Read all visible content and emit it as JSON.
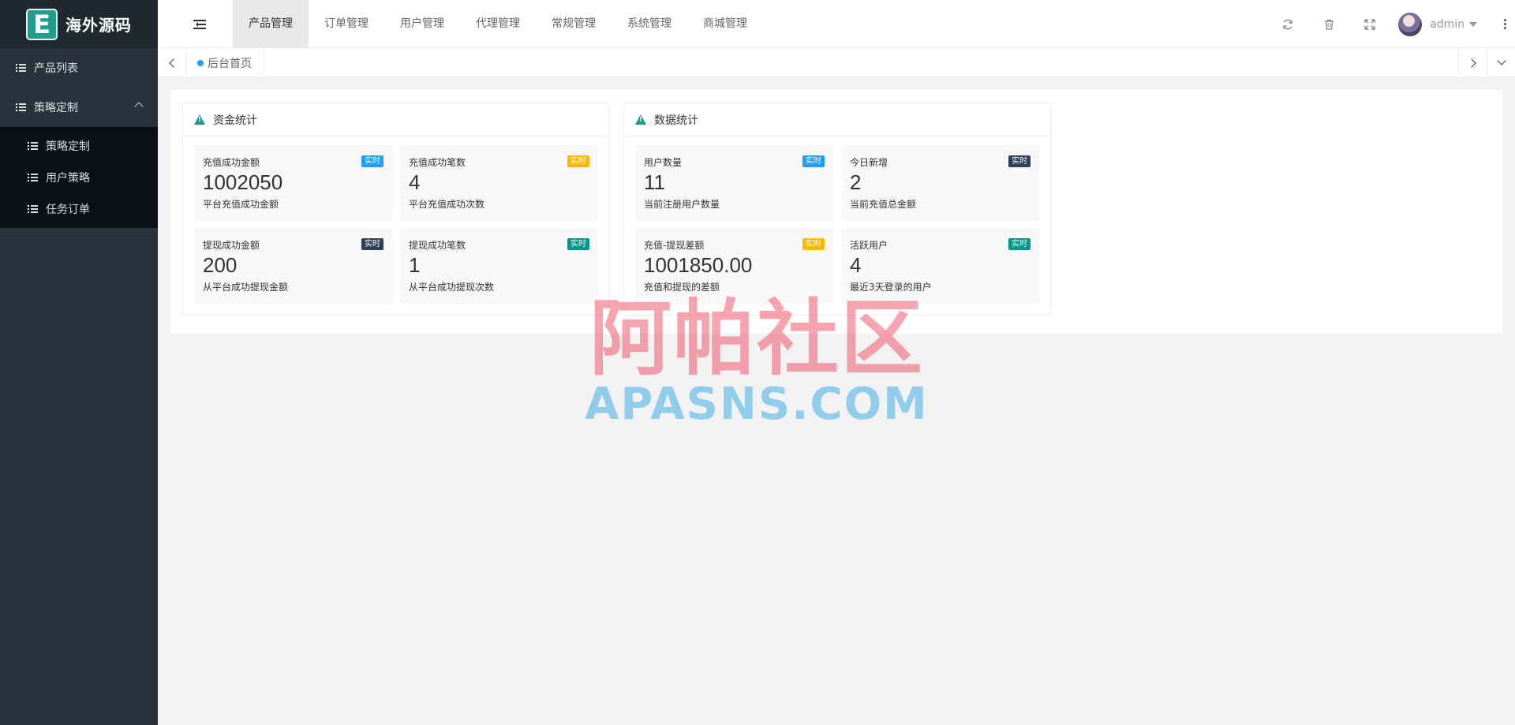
{
  "brand": {
    "logo_letter": "E",
    "name": "海外源码"
  },
  "sidebar": {
    "items": [
      {
        "label": "产品列表"
      },
      {
        "label": "策略定制",
        "expanded": true
      }
    ],
    "submenu": [
      {
        "label": "策略定制"
      },
      {
        "label": "用户策略"
      },
      {
        "label": "任务订单"
      }
    ]
  },
  "topnav": [
    {
      "label": "产品管理",
      "active": true
    },
    {
      "label": "订单管理"
    },
    {
      "label": "用户管理"
    },
    {
      "label": "代理管理"
    },
    {
      "label": "常规管理"
    },
    {
      "label": "系统管理"
    },
    {
      "label": "商城管理"
    }
  ],
  "header": {
    "icons": [
      "refresh-icon",
      "trash-icon",
      "fullscreen-icon"
    ],
    "user_name": "admin"
  },
  "tabs": {
    "home_label": "后台首页"
  },
  "panels": [
    {
      "title": "资金统计",
      "stats": [
        {
          "title": "充值成功金额",
          "badge": "实时",
          "badge_color": "#1e9fff",
          "value": "1002050",
          "desc": "平台充值成功金额"
        },
        {
          "title": "充值成功笔数",
          "badge": "实时",
          "badge_color": "#ffb800",
          "value": "4",
          "desc": "平台充值成功次数"
        },
        {
          "title": "提现成功金额",
          "badge": "实时",
          "badge_color": "#2f4056",
          "value": "200",
          "desc": "从平台成功提现金额"
        },
        {
          "title": "提现成功笔数",
          "badge": "实时",
          "badge_color": "#009688",
          "value": "1",
          "desc": "从平台成功提现次数"
        }
      ]
    },
    {
      "title": "数据统计",
      "stats": [
        {
          "title": "用户数量",
          "badge": "实时",
          "badge_color": "#1e9fff",
          "value": "11",
          "desc": "当前注册用户数量"
        },
        {
          "title": "今日新增",
          "badge": "实时",
          "badge_color": "#2f4056",
          "value": "2",
          "desc": "当前充值总金额"
        },
        {
          "title": "充值-提现差额",
          "badge": "实时",
          "badge_color": "#ffb800",
          "value": "1001850.00",
          "desc": "充值和提现的差额"
        },
        {
          "title": "活跃用户",
          "badge": "实时",
          "badge_color": "#009688",
          "value": "4",
          "desc": "最近3天登录的用户"
        }
      ]
    }
  ],
  "watermark": {
    "cn": "阿帕社区",
    "en": "APASNS.COM"
  }
}
